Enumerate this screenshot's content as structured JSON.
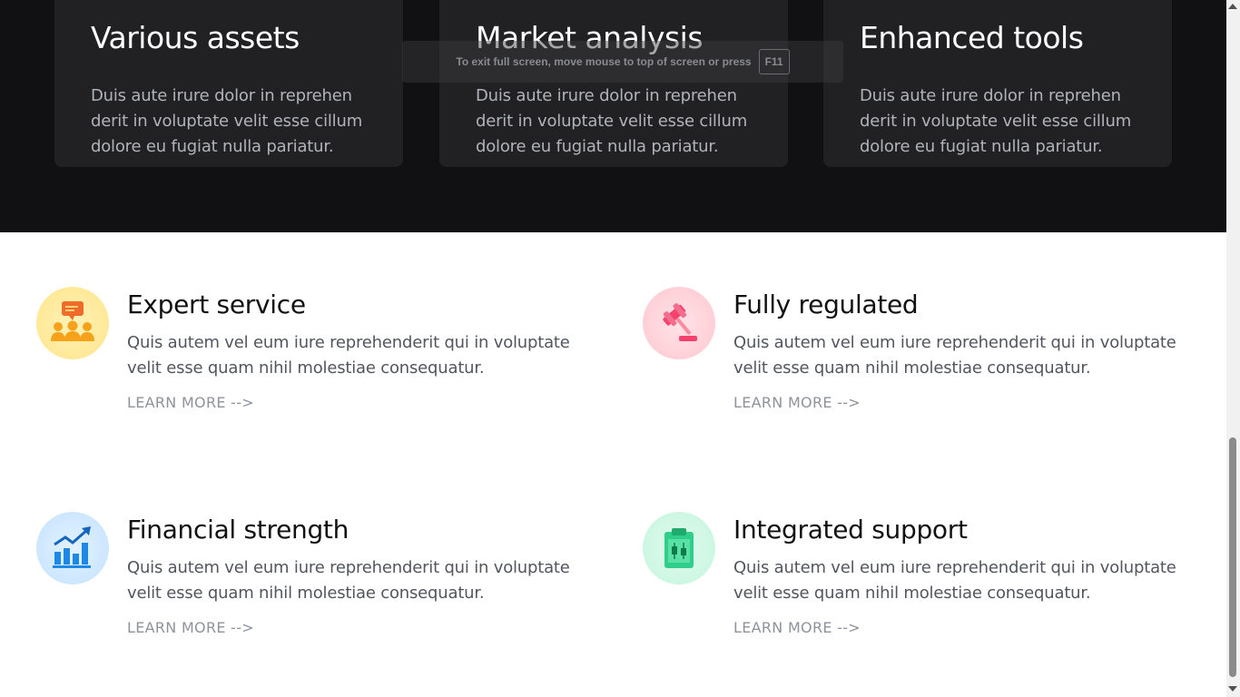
{
  "top_cards": [
    {
      "title": "Various assets",
      "text": "Duis aute irure dolor in reprehen derit in voluptate velit esse cillum dolore eu fugiat nulla pariatur."
    },
    {
      "title": "Market analysis",
      "text": "Duis aute irure dolor in reprehen derit in voluptate velit esse cillum dolore eu fugiat nulla pariatur."
    },
    {
      "title": "Enhanced tools",
      "text": "Duis aute irure dolor in reprehen derit in voluptate velit esse cillum dolore eu fugiat nulla pariatur."
    }
  ],
  "fullscreen_notice": {
    "text": "To exit full screen, move mouse to top of screen or press",
    "key": "F11"
  },
  "features": [
    {
      "title": "Expert service",
      "text": "Quis autem vel eum iure reprehenderit qui in voluptate velit esse quam nihil molestiae consequatur.",
      "link": "LEARN MORE -->",
      "icon": "team-chat-icon"
    },
    {
      "title": "Fully regulated",
      "text": "Quis autem vel eum iure reprehenderit qui in voluptate velit esse quam nihil molestiae consequatur.",
      "link": "LEARN MORE -->",
      "icon": "gavel-icon"
    },
    {
      "title": "Financial strength",
      "text": "Quis autem vel eum iure reprehenderit qui in voluptate velit esse quam nihil molestiae consequatur.",
      "link": "LEARN MORE -->",
      "icon": "bar-chart-growth-icon"
    },
    {
      "title": "Integrated support",
      "text": "Quis autem vel eum iure reprehenderit qui in voluptate velit esse quam nihil molestiae consequatur.",
      "link": "LEARN MORE -->",
      "icon": "clipboard-candlestick-icon"
    }
  ],
  "colors": {
    "dark_bg": "#111113",
    "card_bg": "#212124",
    "link_gray": "#8e939b"
  }
}
